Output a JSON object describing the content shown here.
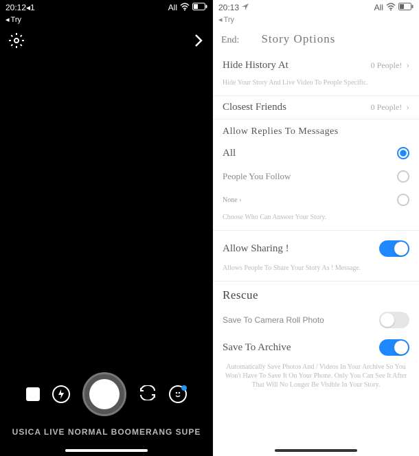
{
  "left": {
    "status": {
      "time": "20:12◂1",
      "carrier": "All"
    },
    "back_label": "Try",
    "modes": "USICA LIVE NORMAL BOOMERANG SUPE"
  },
  "right": {
    "status": {
      "time": "20:13",
      "carrier": "All"
    },
    "back_label": "Try",
    "header": {
      "end": "End:",
      "title": "Story Options"
    },
    "hide_history": {
      "label": "Hide History At",
      "value": "0 People!",
      "desc": "Hide Your Story And Live Video To People Specific."
    },
    "closest_friends": {
      "label": "Closest Friends",
      "value": "0 People!"
    },
    "replies": {
      "title": "Allow Replies To Messages",
      "opt_all": "All",
      "opt_follow": "People You Follow",
      "opt_none": "None ›",
      "desc": "Choose Who Can Answer Your Story."
    },
    "sharing": {
      "label": "Allow Sharing !",
      "desc": "Allows People To Share Your Story As ! Message."
    },
    "rescue": {
      "title": "Rescue",
      "save_roll": "Save To Camera Roll Photo",
      "save_archive": "Save To Archive",
      "desc": "Automatically Save Photos And / Videos In Your Archive So You Won't Have To Save It On Your Phone. Only You Can See It After That Will No Longer Be Visible In Your Story."
    }
  }
}
